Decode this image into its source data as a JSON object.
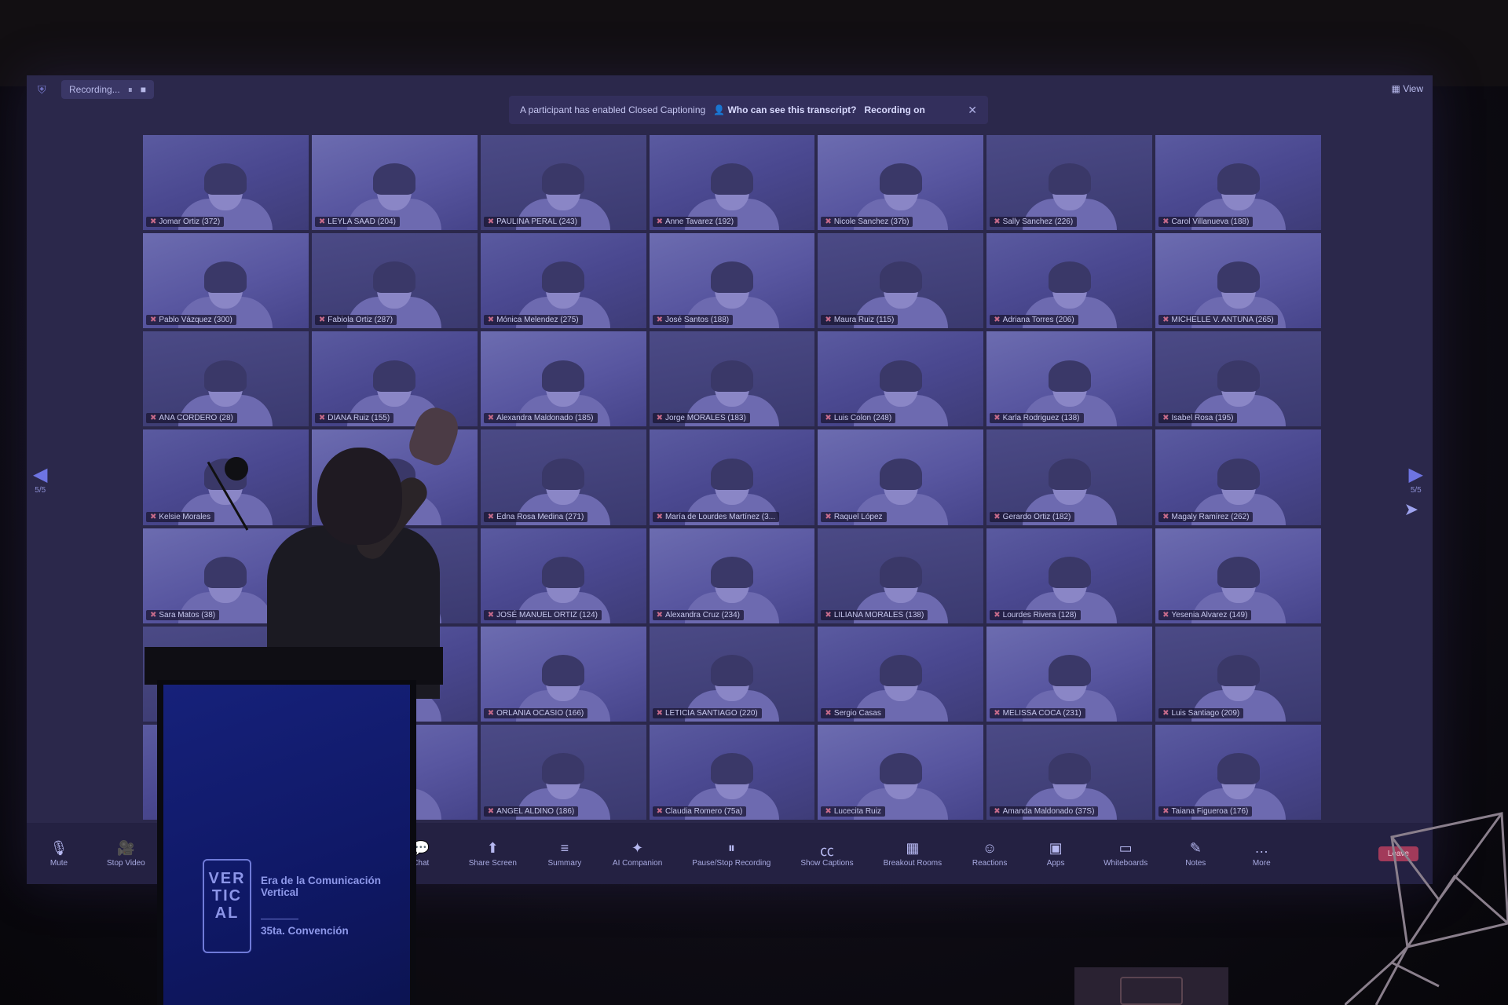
{
  "topbar": {
    "recording_label": "Recording...",
    "meeting_title": "",
    "view_label": "View"
  },
  "banner": {
    "message": "A participant has enabled Closed Captioning",
    "link": "Who can see this transcript?",
    "extra": "Recording on"
  },
  "pager": {
    "left": "5/5",
    "right": "5/5"
  },
  "tiles": [
    {
      "name": "Jomar Ortiz (372)"
    },
    {
      "name": "LEYLA SAAD (204)"
    },
    {
      "name": "PAULINA PERAL (243)"
    },
    {
      "name": "Anne Tavarez (192)"
    },
    {
      "name": "Nicole Sanchez (37b)"
    },
    {
      "name": "Sally Sanchez (226)"
    },
    {
      "name": "Carol Villanueva (188)"
    },
    {
      "name": "Pablo Vázquez (300)"
    },
    {
      "name": "Fabiola Ortiz (287)"
    },
    {
      "name": "Mónica Melendez (275)"
    },
    {
      "name": "José Santos (188)"
    },
    {
      "name": "Maura Ruiz (115)"
    },
    {
      "name": "Adriana Torres (206)"
    },
    {
      "name": "MICHELLE V. ANTUNA (265)"
    },
    {
      "name": "ANA CORDERO (28)"
    },
    {
      "name": "DIANA Ruiz (155)"
    },
    {
      "name": "Alexandra Maldonado (185)"
    },
    {
      "name": "Jorge MORALES (183)"
    },
    {
      "name": "Luis Colon (248)"
    },
    {
      "name": "Karla Rodriguez (138)"
    },
    {
      "name": "Isabel Rosa (195)"
    },
    {
      "name": "Kelsie Morales"
    },
    {
      "name": ""
    },
    {
      "name": "Edna Rosa Medina (271)"
    },
    {
      "name": "María de Lourdes Martínez (3..."
    },
    {
      "name": "Raquel López"
    },
    {
      "name": "Gerardo Ortiz (182)"
    },
    {
      "name": "Magaly Ramírez (262)"
    },
    {
      "name": "Sara Matos (38)"
    },
    {
      "name": ""
    },
    {
      "name": "JOSÉ MANUEL ORTIZ (124)"
    },
    {
      "name": "Alexandra Cruz (234)"
    },
    {
      "name": "LILIANA MORALES (138)"
    },
    {
      "name": "Lourdes Rivera (128)"
    },
    {
      "name": "Yesenia Alvarez (149)"
    },
    {
      "name": ""
    },
    {
      "name": ""
    },
    {
      "name": "ORLANIA OCASIO (166)"
    },
    {
      "name": "LETICIA SANTIAGO (220)"
    },
    {
      "name": "Sergio Casas"
    },
    {
      "name": "MELISSA COCA (231)"
    },
    {
      "name": "Luis Santiago (209)"
    },
    {
      "name": ""
    },
    {
      "name": ""
    },
    {
      "name": "ANGEL ALDINO (186)"
    },
    {
      "name": "Claudia Romero (75a)"
    },
    {
      "name": "Lucecita Ruiz"
    },
    {
      "name": "Amanda Maldonado (37S)"
    },
    {
      "name": "Taiana Figueroa (176)"
    }
  ],
  "toolbar": {
    "left": [
      {
        "label": "Mute",
        "icon": "microphone-icon"
      },
      {
        "label": "Stop Video",
        "icon": "video-camera-icon"
      }
    ],
    "center": [
      {
        "label": "Chat",
        "icon": "chat-icon"
      },
      {
        "label": "Share Screen",
        "icon": "share-screen-icon"
      },
      {
        "label": "Summary",
        "icon": "summary-icon"
      },
      {
        "label": "AI Companion",
        "icon": "sparkle-icon"
      },
      {
        "label": "Pause/Stop Recording",
        "icon": "pause-icon"
      },
      {
        "label": "Show Captions",
        "icon": "cc-icon"
      },
      {
        "label": "Breakout Rooms",
        "icon": "breakout-icon"
      },
      {
        "label": "Reactions",
        "icon": "emoji-icon"
      },
      {
        "label": "Apps",
        "icon": "apps-icon"
      },
      {
        "label": "Whiteboards",
        "icon": "whiteboard-icon"
      },
      {
        "label": "Notes",
        "icon": "notes-icon"
      },
      {
        "label": "More",
        "icon": "more-icon"
      }
    ],
    "leave": "Leave"
  },
  "podium": {
    "logo_letters": "VER\nTIC\nAL",
    "tagline": "Era de la Comunicación Vertical",
    "edition": "35ta. Convención"
  },
  "colors": {
    "screen_tint": "#2b284b",
    "podium_blue": "#16217a",
    "leave_red": "#a23a5a",
    "accent": "#6e74e2"
  }
}
